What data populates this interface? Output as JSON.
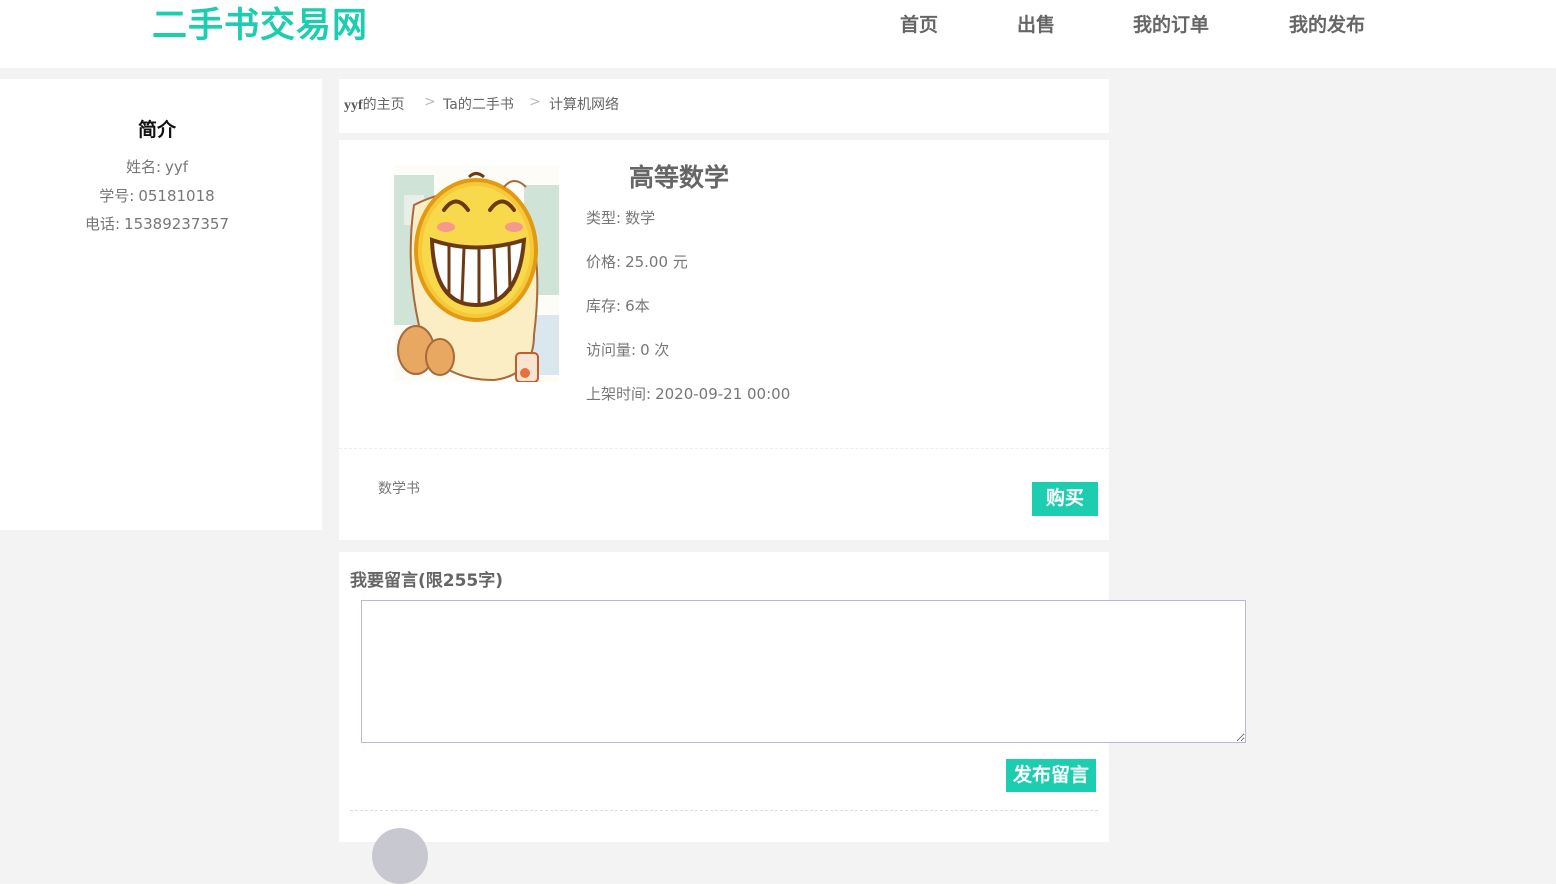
{
  "header": {
    "logo": "二手书交易网",
    "nav": [
      "首页",
      "出售",
      "我的订单",
      "我的发布"
    ]
  },
  "profile": {
    "title": "简介",
    "name_label": "姓名:",
    "name_value": "yyf",
    "id_label": "学号:",
    "id_value": "05181018",
    "phone_label": "电话:",
    "phone_value": "15389237357"
  },
  "breadcrumb": {
    "home_user": "yyf",
    "home_suffix": "的主页",
    "sep": ">",
    "shop": "Ta的二手书",
    "category": "计算机网络"
  },
  "book": {
    "title": "高等数学",
    "type_label": "类型:",
    "type_value": "数学",
    "price_label": "价格:",
    "price_value": "25.00 元",
    "stock_label": "库存:",
    "stock_value": "6本",
    "views_label": "访问量:",
    "views_value": "0 次",
    "listed_label": "上架时间:",
    "listed_value": "2020-09-21 00:00",
    "description": "数学书",
    "buy_label": "购买"
  },
  "comment": {
    "heading": "我要留言(限255字)",
    "input_value": "",
    "post_label": "发布留言"
  },
  "colors": {
    "accent": "#1ccdb0",
    "background": "#f3f3f3",
    "panel": "#ffffff",
    "text": "#666666"
  }
}
